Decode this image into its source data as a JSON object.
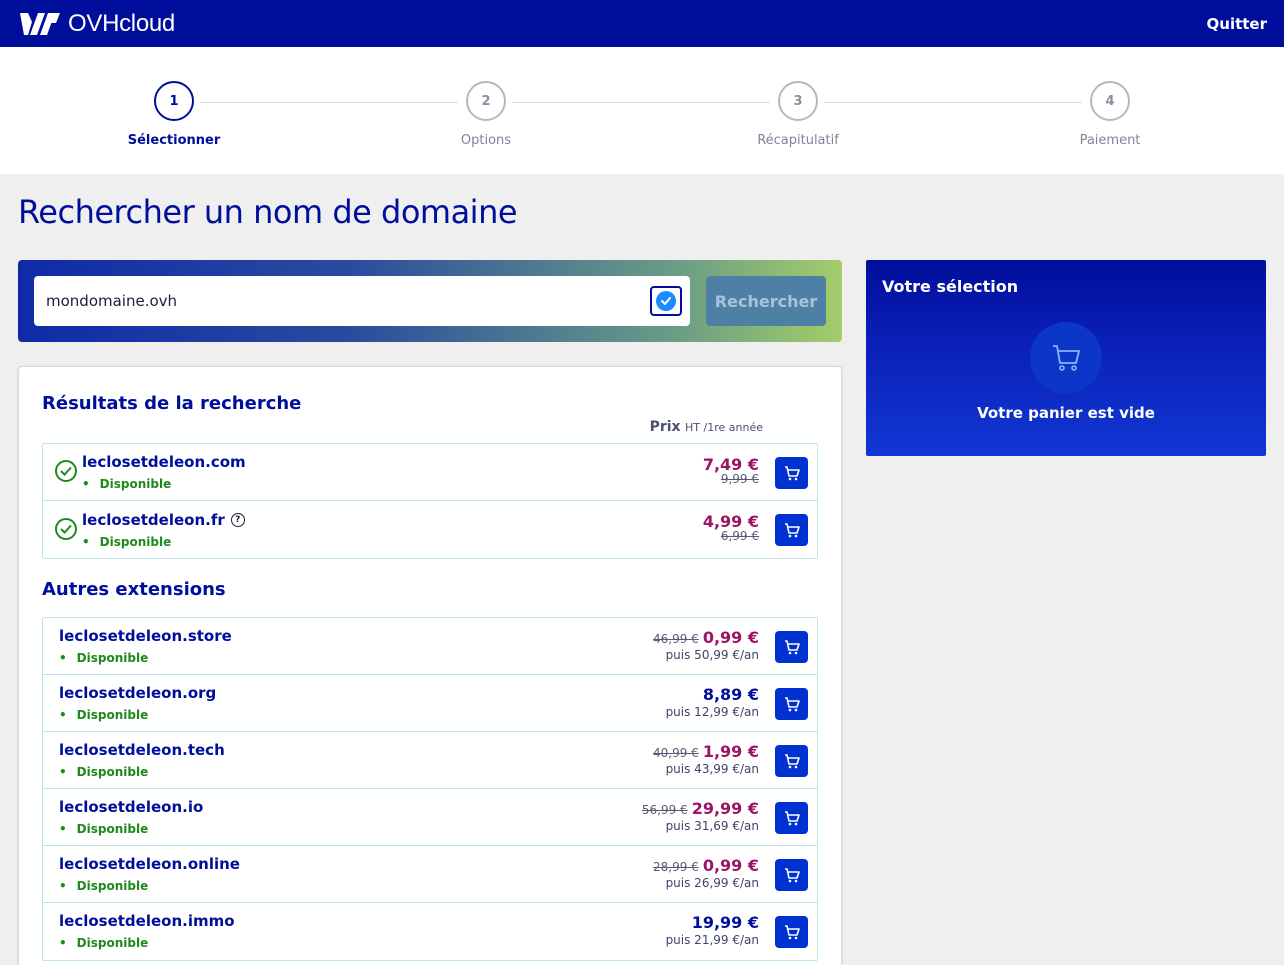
{
  "header": {
    "brand": "OVHcloud",
    "quit_label": "Quitter"
  },
  "stepper": [
    {
      "num": "1",
      "label": "Sélectionner"
    },
    {
      "num": "2",
      "label": "Options"
    },
    {
      "num": "3",
      "label": "Récapitulatif"
    },
    {
      "num": "4",
      "label": "Paiement"
    }
  ],
  "page_title": "Rechercher un nom de domaine",
  "search": {
    "value": "mondomaine.ovh",
    "button_label": "Rechercher"
  },
  "results": {
    "heading": "Résultats de la recherche",
    "price_heading": "Prix",
    "price_note": "HT /1re année",
    "items": [
      {
        "domain": "leclosetdeleon.com",
        "status": "Disponible",
        "price": "7,49 €",
        "old_price": "9,99 €"
      },
      {
        "domain": "leclosetdeleon.fr",
        "status": "Disponible",
        "price": "4,99 €",
        "old_price": "6,99 €"
      }
    ]
  },
  "other": {
    "heading": "Autres extensions",
    "items": [
      {
        "domain": "leclosetdeleon.store",
        "status": "Disponible",
        "old_price": "46,99 €",
        "price": "0,99 €",
        "renewal": "puis 50,99 €/an"
      },
      {
        "domain": "leclosetdeleon.org",
        "status": "Disponible",
        "old_price": "",
        "price": "8,89 €",
        "renewal": "puis 12,99 €/an"
      },
      {
        "domain": "leclosetdeleon.tech",
        "status": "Disponible",
        "old_price": "40,99 €",
        "price": "1,99 €",
        "renewal": "puis 43,99 €/an"
      },
      {
        "domain": "leclosetdeleon.io",
        "status": "Disponible",
        "old_price": "56,99 €",
        "price": "29,99 €",
        "renewal": "puis 31,69 €/an"
      },
      {
        "domain": "leclosetdeleon.online",
        "status": "Disponible",
        "old_price": "28,99 €",
        "price": "0,99 €",
        "renewal": "puis 26,99 €/an"
      },
      {
        "domain": "leclosetdeleon.immo",
        "status": "Disponible",
        "old_price": "",
        "price": "19,99 €",
        "renewal": "puis 21,99 €/an"
      }
    ]
  },
  "selection": {
    "title": "Votre sélection",
    "empty_text": "Votre panier est vide"
  },
  "colors": {
    "brand": "#000e9c",
    "promo_price": "#9e1363",
    "available": "#1e8a1e",
    "cart_button": "#0032d2"
  }
}
